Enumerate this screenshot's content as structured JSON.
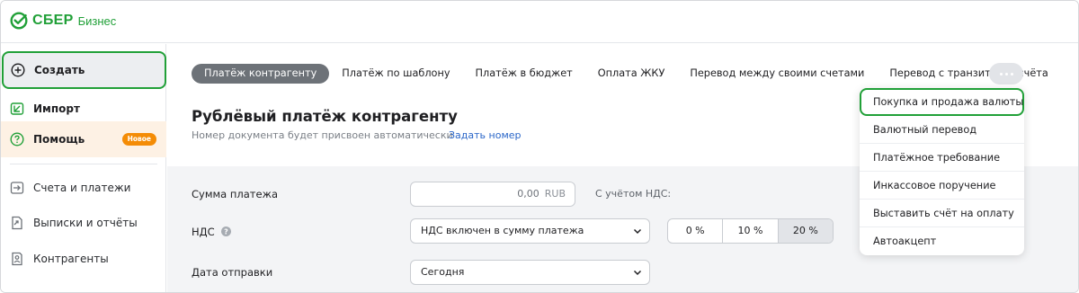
{
  "brand": {
    "name": "СБЕР",
    "sub": "Бизнес",
    "color": "#21a038"
  },
  "sidebar": {
    "items": [
      {
        "label": "Создать",
        "icon": "plus-circle-icon"
      },
      {
        "label": "Импорт",
        "icon": "import-icon"
      },
      {
        "label": "Помощь",
        "icon": "help-circle-icon",
        "badge": "Новое"
      },
      {
        "label": "Счета и платежи",
        "icon": "arrow-in-box-icon"
      },
      {
        "label": "Выписки и отчёты",
        "icon": "document-export-icon"
      },
      {
        "label": "Контрагенты",
        "icon": "contacts-icon"
      }
    ]
  },
  "tabs": [
    {
      "label": "Платёж контрагенту",
      "selected": true
    },
    {
      "label": "Платёж по шаблону"
    },
    {
      "label": "Платёж в бюджет"
    },
    {
      "label": "Оплата ЖКУ"
    },
    {
      "label": "Перевод между своими счетами"
    },
    {
      "label": "Перевод с транзитного счёта"
    }
  ],
  "more_button": {
    "icon": "more-dots-icon"
  },
  "page": {
    "title": "Рублёвый платёж контрагенту",
    "note": "Номер документа будет присвоен автоматически",
    "link": "Задать номер"
  },
  "form": {
    "amount": {
      "label": "Сумма платежа",
      "value": "0,00",
      "currency": "RUB",
      "vat_note": "С учётом НДС:"
    },
    "vat": {
      "label": "НДС",
      "value": "НДС включен в сумму платежа",
      "rates": [
        "0 %",
        "10 %",
        "20 %"
      ],
      "selected_rate": "20 %"
    },
    "date": {
      "label": "Дата отправки",
      "value": "Сегодня"
    }
  },
  "dropdown": {
    "items": [
      {
        "label": "Покупка и продажа валюты",
        "highlighted": true
      },
      {
        "label": "Валютный перевод"
      },
      {
        "label": "Платёжное требование"
      },
      {
        "label": "Инкассовое поручение"
      },
      {
        "label": "Выставить счёт на оплату"
      },
      {
        "label": "Автоакцепт"
      }
    ]
  }
}
